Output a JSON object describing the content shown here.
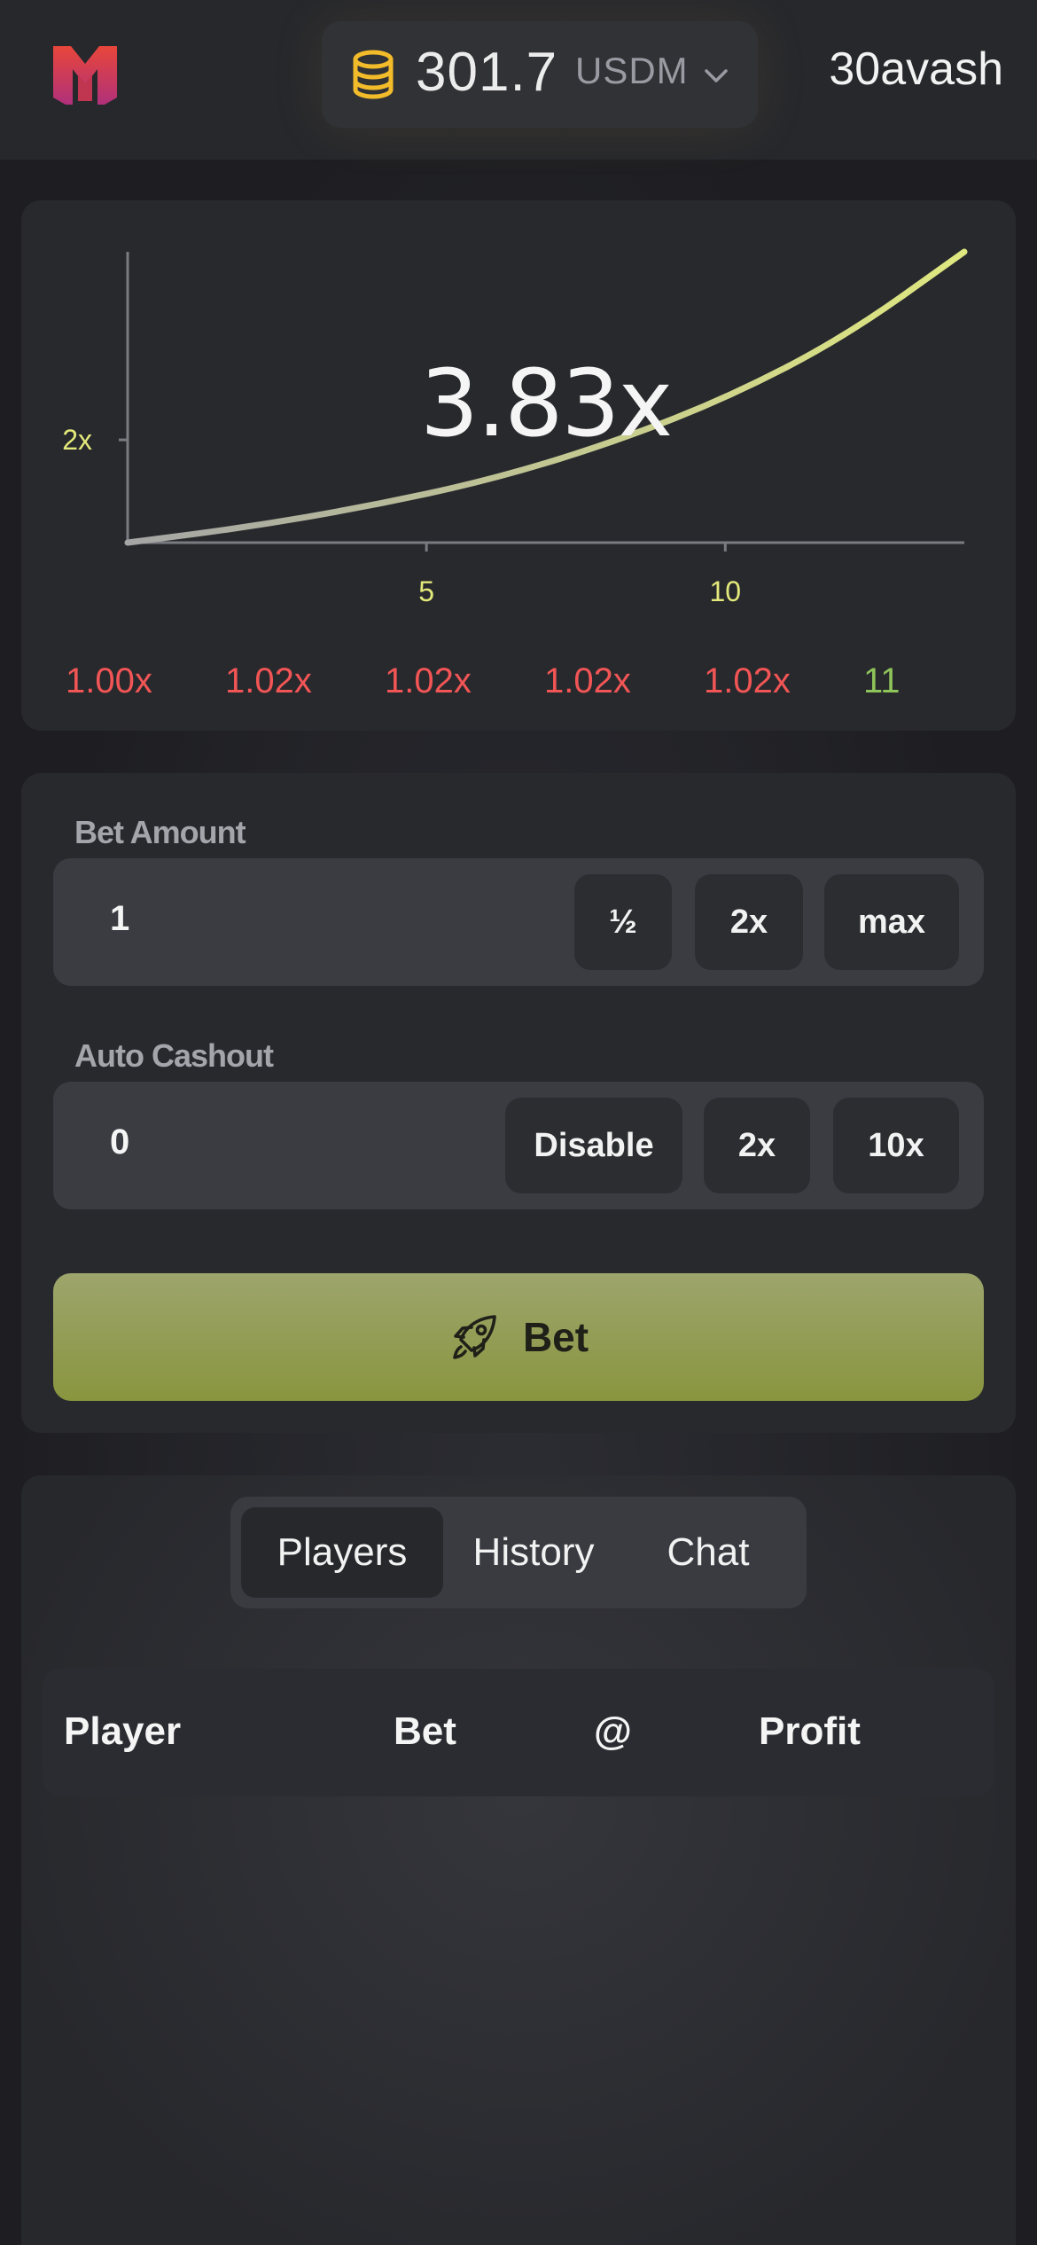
{
  "header": {
    "balance": "301.7",
    "currency": "USDM",
    "username": "30avash"
  },
  "chart": {
    "multiplier": "3.83x",
    "y_tick": "2x",
    "x_ticks": [
      "5",
      "10"
    ]
  },
  "chart_data": {
    "type": "line",
    "x": [
      0,
      2,
      4,
      6,
      8,
      10,
      12,
      14
    ],
    "values": [
      1.0,
      1.15,
      1.35,
      1.6,
      1.95,
      2.4,
      3.0,
      3.83
    ],
    "xlim": [
      0,
      14
    ],
    "ylim": [
      1,
      3.83
    ],
    "x_ticks": [
      "5",
      "10"
    ],
    "y_ticks": [
      "2x"
    ],
    "title": "",
    "xlabel": "",
    "ylabel": "",
    "line_color": "#d7e070"
  },
  "history": [
    {
      "value": "1.00x",
      "win": false
    },
    {
      "value": "1.02x",
      "win": false
    },
    {
      "value": "1.02x",
      "win": false
    },
    {
      "value": "1.02x",
      "win": false
    },
    {
      "value": "1.02x",
      "win": false
    },
    {
      "value": "11",
      "win": true
    }
  ],
  "bet_form": {
    "bet_amount_label": "Bet Amount",
    "bet_amount_value": "1",
    "half_label": "½",
    "double_label": "2x",
    "max_label": "max",
    "auto_cashout_label": "Auto Cashout",
    "auto_cashout_value": "0",
    "disable_label": "Disable",
    "cashout_2x_label": "2x",
    "cashout_10x_label": "10x",
    "bet_button_label": "Bet"
  },
  "tabs": {
    "items": [
      "Players",
      "History",
      "Chat"
    ],
    "active": "Players"
  },
  "table": {
    "columns": [
      "Player",
      "Bet",
      "@",
      "Profit"
    ]
  },
  "colors": {
    "accent": "#8a953f",
    "loss": "#f25555",
    "win": "#8fc45a",
    "tick": "#e3e97a"
  }
}
